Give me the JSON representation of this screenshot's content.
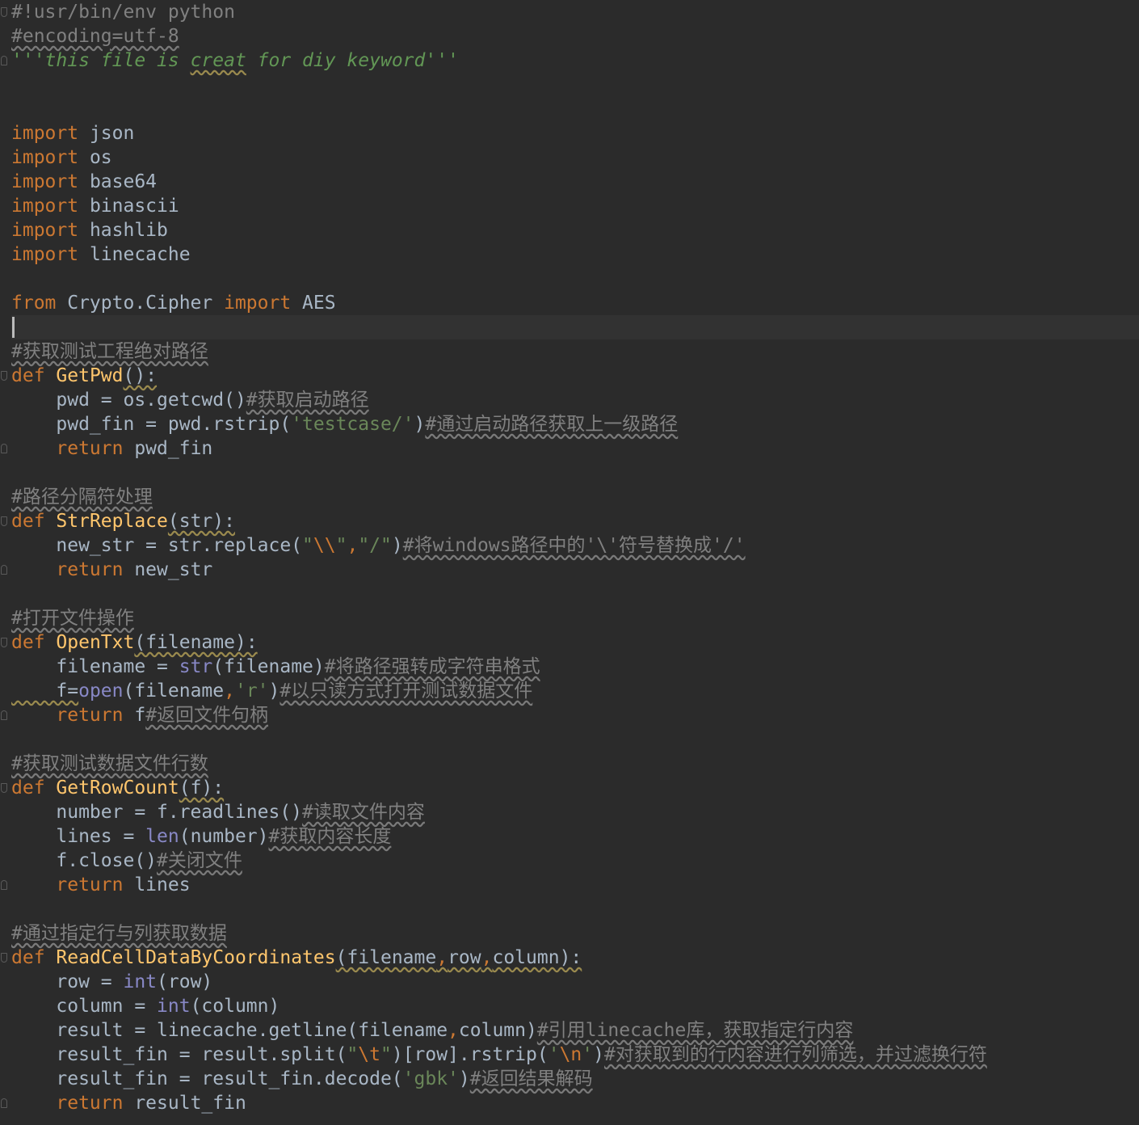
{
  "editor": {
    "language": "python",
    "theme": "dark",
    "caret_line": 14,
    "colors": {
      "background": "#2b2b2b",
      "current_line": "#323232",
      "keyword": "#cc7832",
      "function": "#ffc66d",
      "string": "#6a8759",
      "docstring": "#629755",
      "comment": "#808080",
      "builtin": "#8888c6",
      "text": "#a9b7c6"
    },
    "lines": [
      [
        {
          "t": "#!usr/bin/env python",
          "c": "cm"
        }
      ],
      [
        {
          "t": "#encoding=utf-8",
          "c": "cm wavy-cm"
        }
      ],
      [
        {
          "t": "'''this file is ",
          "c": "doc"
        },
        {
          "t": "creat",
          "c": "doc wavy"
        },
        {
          "t": " for diy keyword'''",
          "c": "doc"
        }
      ],
      [],
      [],
      [
        {
          "t": "import",
          "c": "kw"
        },
        {
          "t": " json"
        }
      ],
      [
        {
          "t": "import",
          "c": "kw"
        },
        {
          "t": " os"
        }
      ],
      [
        {
          "t": "import",
          "c": "kw"
        },
        {
          "t": " base64"
        }
      ],
      [
        {
          "t": "import",
          "c": "kw"
        },
        {
          "t": " binascii"
        }
      ],
      [
        {
          "t": "import",
          "c": "kw"
        },
        {
          "t": " hashlib"
        }
      ],
      [
        {
          "t": "import",
          "c": "kw"
        },
        {
          "t": " linecache"
        }
      ],
      [],
      [
        {
          "t": "from",
          "c": "kw"
        },
        {
          "t": " Crypto.Cipher "
        },
        {
          "t": "import",
          "c": "kw"
        },
        {
          "t": " AES"
        }
      ],
      [],
      [
        {
          "t": "#获取测试工程绝对路径",
          "c": "cm wavy-cm"
        }
      ],
      [
        {
          "t": "def",
          "c": "kw"
        },
        {
          "t": " "
        },
        {
          "t": "GetPwd",
          "c": "fn"
        },
        {
          "t": "():",
          "c": "wavy"
        }
      ],
      [
        {
          "t": "    pwd = os.getcwd()"
        },
        {
          "t": "#获取启动路径",
          "c": "cm wavy-cm"
        }
      ],
      [
        {
          "t": "    pwd_fin = pwd.rstrip("
        },
        {
          "t": "'testcase/'",
          "c": "str"
        },
        {
          "t": ")"
        },
        {
          "t": "#通过启动路径获取上一级路径",
          "c": "cm wavy-cm"
        }
      ],
      [
        {
          "t": "    "
        },
        {
          "t": "return",
          "c": "kw"
        },
        {
          "t": " pwd_fin"
        }
      ],
      [],
      [
        {
          "t": "#路径分隔符处理",
          "c": "cm wavy-cm"
        }
      ],
      [
        {
          "t": "def",
          "c": "kw"
        },
        {
          "t": " "
        },
        {
          "t": "StrReplace",
          "c": "fn"
        },
        {
          "t": "(str):",
          "c": "wavy"
        }
      ],
      [
        {
          "t": "    new_str = str.replace("
        },
        {
          "t": "\"",
          "c": "str"
        },
        {
          "t": "\\\\",
          "c": "esc"
        },
        {
          "t": "\"",
          "c": "str"
        },
        {
          "t": ",",
          "c": "kw"
        },
        {
          "t": "\"/\"",
          "c": "str"
        },
        {
          "t": ")"
        },
        {
          "t": "#将windows路径中的'\\'符号替换成'/'",
          "c": "cm wavy-cm"
        }
      ],
      [
        {
          "t": "    "
        },
        {
          "t": "return",
          "c": "kw"
        },
        {
          "t": " new_str"
        }
      ],
      [],
      [
        {
          "t": "#打开文件操作",
          "c": "cm wavy-cm"
        }
      ],
      [
        {
          "t": "def",
          "c": "kw"
        },
        {
          "t": " "
        },
        {
          "t": "OpenTxt",
          "c": "fn"
        },
        {
          "t": "(filename):",
          "c": "wavy"
        }
      ],
      [
        {
          "t": "    filename = "
        },
        {
          "t": "str",
          "c": "bi"
        },
        {
          "t": "(filename)"
        },
        {
          "t": "#将路径强转成字符串格式",
          "c": "cm wavy-cm"
        }
      ],
      [
        {
          "t": "    f=",
          "c": "wavy"
        },
        {
          "t": "open",
          "c": "bi"
        },
        {
          "t": "(filename"
        },
        {
          "t": ",",
          "c": "kw"
        },
        {
          "t": "'r'",
          "c": "str"
        },
        {
          "t": ")"
        },
        {
          "t": "#以只读方式打开测试数据文件",
          "c": "cm wavy-cm"
        }
      ],
      [
        {
          "t": "    "
        },
        {
          "t": "return",
          "c": "kw"
        },
        {
          "t": " f"
        },
        {
          "t": "#返回文件句柄",
          "c": "cm wavy-cm"
        }
      ],
      [],
      [
        {
          "t": "#获取测试数据文件行数",
          "c": "cm wavy-cm"
        }
      ],
      [
        {
          "t": "def",
          "c": "kw"
        },
        {
          "t": " "
        },
        {
          "t": "GetRowCount",
          "c": "fn"
        },
        {
          "t": "(f):",
          "c": "wavy"
        }
      ],
      [
        {
          "t": "    number = f.readlines()"
        },
        {
          "t": "#读取文件内容",
          "c": "cm wavy-cm"
        }
      ],
      [
        {
          "t": "    lines = "
        },
        {
          "t": "len",
          "c": "bi"
        },
        {
          "t": "(number)"
        },
        {
          "t": "#获取内容长度",
          "c": "cm wavy-cm"
        }
      ],
      [
        {
          "t": "    f.close()"
        },
        {
          "t": "#关闭文件",
          "c": "cm wavy-cm"
        }
      ],
      [
        {
          "t": "    "
        },
        {
          "t": "return",
          "c": "kw"
        },
        {
          "t": " lines"
        }
      ],
      [],
      [
        {
          "t": "#通过指定行与列获取数据",
          "c": "cm wavy-cm"
        }
      ],
      [
        {
          "t": "def",
          "c": "kw"
        },
        {
          "t": " "
        },
        {
          "t": "ReadCellDataByCoordinates",
          "c": "fn"
        },
        {
          "t": "(filename",
          "c": "wavy"
        },
        {
          "t": ",",
          "c": "kw wavy"
        },
        {
          "t": "row",
          "c": "wavy"
        },
        {
          "t": ",",
          "c": "kw wavy"
        },
        {
          "t": "column):",
          "c": "wavy"
        }
      ],
      [
        {
          "t": "    row = "
        },
        {
          "t": "int",
          "c": "bi"
        },
        {
          "t": "(row)"
        }
      ],
      [
        {
          "t": "    column = "
        },
        {
          "t": "int",
          "c": "bi"
        },
        {
          "t": "(column)"
        }
      ],
      [
        {
          "t": "    result = linecache.getline(filename"
        },
        {
          "t": ",",
          "c": "kw"
        },
        {
          "t": "column)"
        },
        {
          "t": "#引用linecache库，获取指定行内容",
          "c": "cm wavy-cm"
        }
      ],
      [
        {
          "t": "    result_fin = result.split("
        },
        {
          "t": "\"",
          "c": "str"
        },
        {
          "t": "\\t",
          "c": "esc"
        },
        {
          "t": "\"",
          "c": "str"
        },
        {
          "t": ")[row].rstrip("
        },
        {
          "t": "'",
          "c": "str"
        },
        {
          "t": "\\n",
          "c": "esc"
        },
        {
          "t": "'",
          "c": "str"
        },
        {
          "t": ")"
        },
        {
          "t": "#对获取到的行内容进行列筛选，并过滤换行符",
          "c": "cm wavy-cm"
        }
      ],
      [
        {
          "t": "    result_fin = result_fin.decode("
        },
        {
          "t": "'gbk'",
          "c": "str"
        },
        {
          "t": ")"
        },
        {
          "t": "#返回结果解码",
          "c": "cm wavy-cm"
        }
      ],
      [
        {
          "t": "    "
        },
        {
          "t": "return",
          "c": "kw"
        },
        {
          "t": " result_fin"
        }
      ]
    ]
  }
}
